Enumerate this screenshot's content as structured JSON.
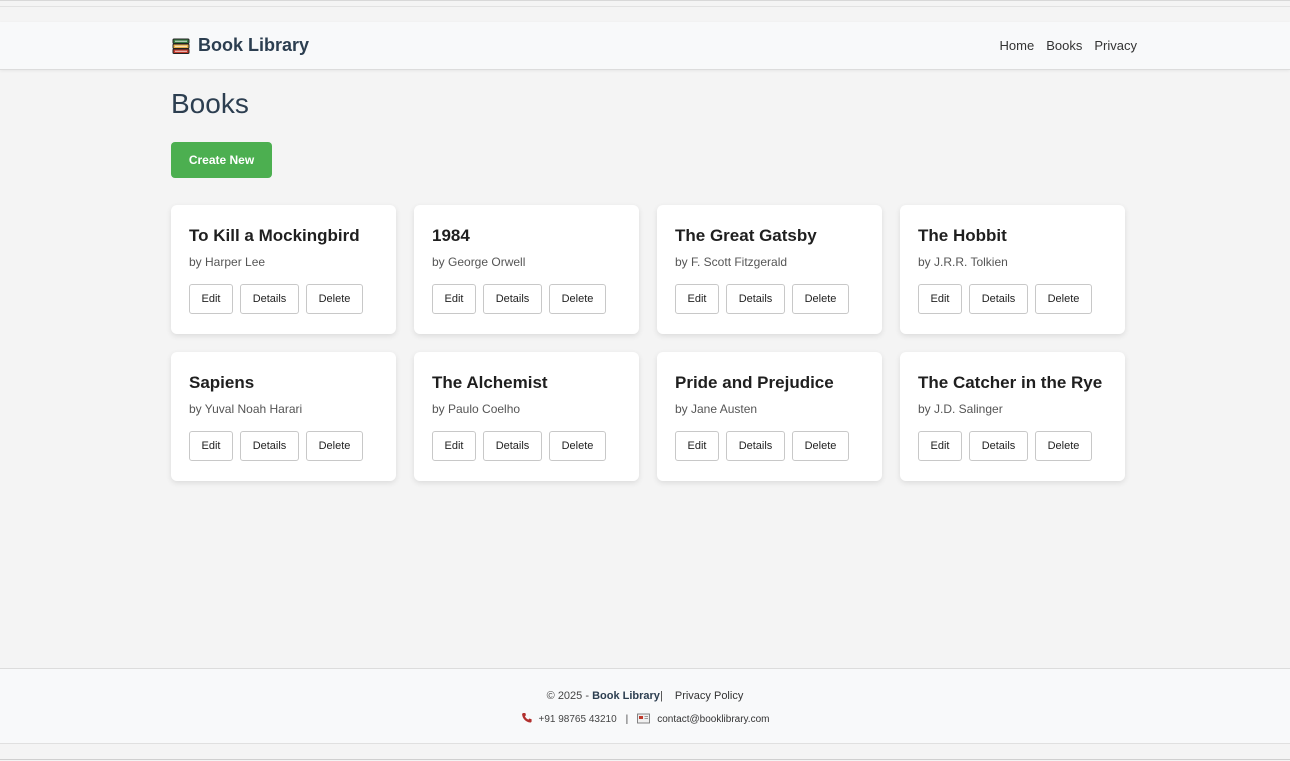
{
  "navbar": {
    "brand": "Book Library",
    "brand_icon": "books-icon",
    "links": [
      "Home",
      "Books",
      "Privacy"
    ]
  },
  "main": {
    "title": "Books",
    "create_label": "Create New",
    "accent_color": "#4caf50"
  },
  "books": [
    {
      "title": "To Kill a Mockingbird",
      "author": "by Harper Lee"
    },
    {
      "title": "1984",
      "author": "by George Orwell"
    },
    {
      "title": "The Great Gatsby",
      "author": "by F. Scott Fitzgerald"
    },
    {
      "title": "The Hobbit",
      "author": "by J.R.R. Tolkien"
    },
    {
      "title": "Sapiens",
      "author": "by Yuval Noah Harari"
    },
    {
      "title": "The Alchemist",
      "author": "by Paulo Coelho"
    },
    {
      "title": "Pride and Prejudice",
      "author": "by Jane Austen"
    },
    {
      "title": "The Catcher in the Rye",
      "author": "by J.D. Salinger"
    }
  ],
  "card_actions": {
    "edit": "Edit",
    "details": "Details",
    "delete": "Delete"
  },
  "footer": {
    "copyright": "© 2025 -",
    "brand": "Book Library",
    "divider": "|",
    "privacy_label": "Privacy Policy",
    "phone": "+91 98765 43210",
    "email": "contact@booklibrary.com"
  }
}
